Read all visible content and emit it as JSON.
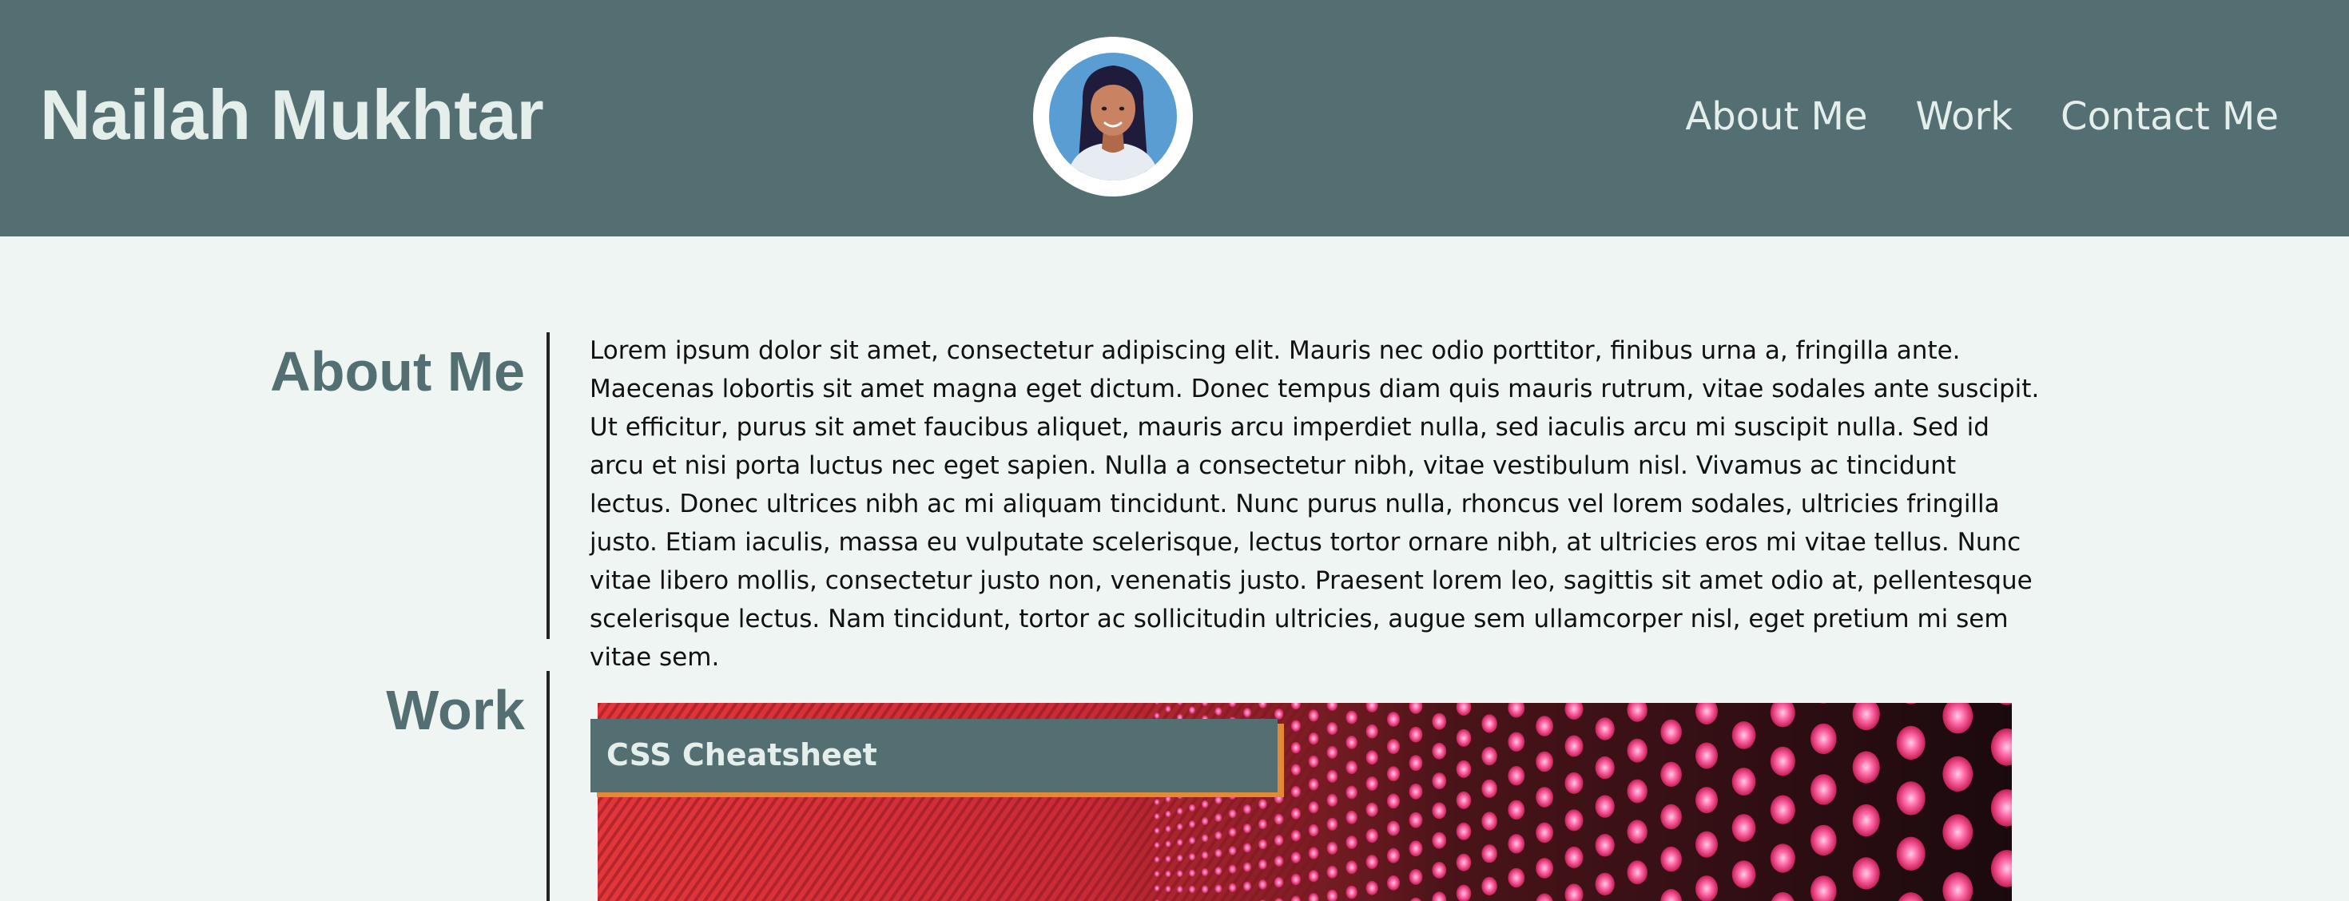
{
  "header": {
    "title": "Nailah Mukhtar",
    "nav": [
      "About Me",
      "Work",
      "Contact Me"
    ]
  },
  "about": {
    "heading": "About Me",
    "text": "Lorem ipsum dolor sit amet, consectetur adipiscing elit. Mauris nec odio porttitor, finibus urna a, fringilla ante. Maecenas lobortis sit amet magna eget dictum. Donec tempus diam quis mauris rutrum, vitae sodales ante suscipit. Ut efficitur, purus sit amet faucibus aliquet, mauris arcu imperdiet nulla, sed iaculis arcu mi suscipit nulla. Sed id arcu et nisi porta luctus nec eget sapien. Nulla a consectetur nibh, vitae vestibulum nisl. Vivamus ac tincidunt lectus. Donec ultrices nibh ac mi aliquam tincidunt. Nunc purus nulla, rhoncus vel lorem sodales, ultricies fringilla justo. Etiam iaculis, massa eu vulputate scelerisque, lectus tortor ornare nibh, at ultricies eros mi vitae tellus. Nunc vitae libero mollis, consectetur justo non, venenatis justo. Praesent lorem leo, sagittis sit amet odio at, pellentesque scelerisque lectus. Nam tincidunt, tortor ac sollicitudin ultricies, augue sem ullamcorper nisl, eget pretium mi sem vitae sem."
  },
  "work": {
    "heading": "Work",
    "projects": [
      {
        "title": "CSS Cheatsheet"
      }
    ]
  },
  "colors": {
    "header_bg": "#546f72",
    "page_bg": "#eef5f3",
    "accent": "#e38a35"
  },
  "icons": {
    "avatar": "woman-avatar-icon"
  }
}
